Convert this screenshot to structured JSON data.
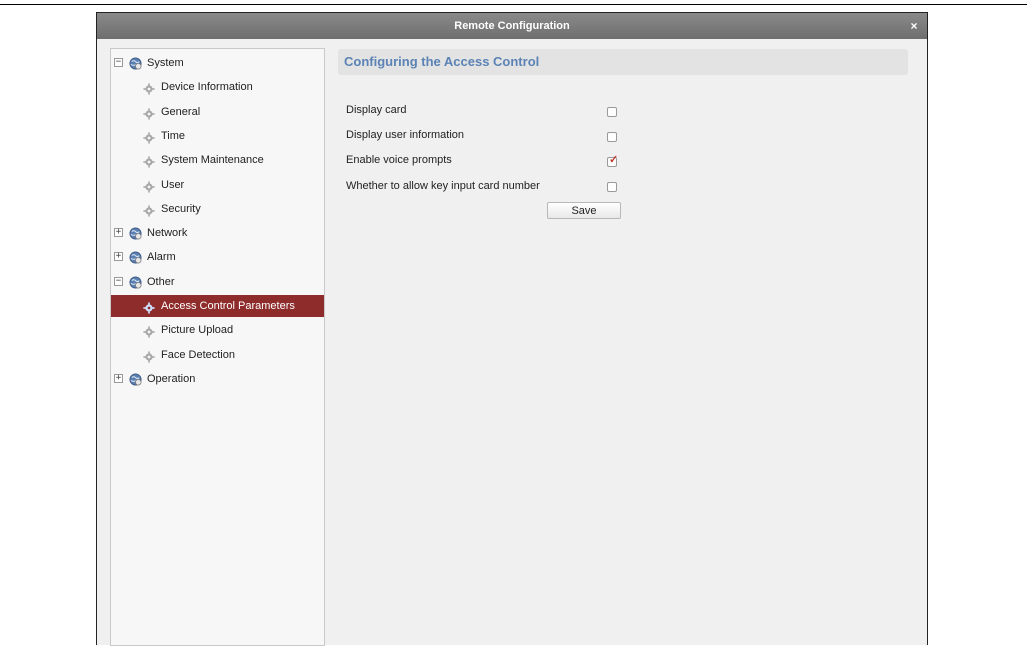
{
  "window": {
    "title": "Remote Configuration",
    "close_label": "×"
  },
  "tree": {
    "items": [
      {
        "label": "System",
        "level": 0,
        "expanded": true,
        "icon": "globe-icon"
      },
      {
        "label": "Device Information",
        "level": 1,
        "icon": "gear-icon"
      },
      {
        "label": "General",
        "level": 1,
        "icon": "gear-icon"
      },
      {
        "label": "Time",
        "level": 1,
        "icon": "gear-icon"
      },
      {
        "label": "System Maintenance",
        "level": 1,
        "icon": "gear-icon"
      },
      {
        "label": "User",
        "level": 1,
        "icon": "gear-icon"
      },
      {
        "label": "Security",
        "level": 1,
        "icon": "gear-icon"
      },
      {
        "label": "Network",
        "level": 0,
        "expanded": false,
        "icon": "globe-icon"
      },
      {
        "label": "Alarm",
        "level": 0,
        "expanded": false,
        "icon": "globe-icon"
      },
      {
        "label": "Other",
        "level": 0,
        "expanded": true,
        "icon": "globe-icon"
      },
      {
        "label": "Access Control Parameters",
        "level": 1,
        "selected": true,
        "icon": "gear-icon"
      },
      {
        "label": "Picture Upload",
        "level": 1,
        "icon": "gear-icon"
      },
      {
        "label": "Face Detection",
        "level": 1,
        "icon": "gear-icon"
      },
      {
        "label": "Operation",
        "level": 0,
        "expanded": false,
        "icon": "globe-icon"
      }
    ]
  },
  "content": {
    "title": "Configuring the Access Control",
    "options": [
      {
        "label": "Display card",
        "checked": false
      },
      {
        "label": "Display user information",
        "checked": false
      },
      {
        "label": "Enable voice prompts",
        "checked": true
      },
      {
        "label": "Whether to allow key input card number",
        "checked": false
      }
    ],
    "save_label": "Save"
  },
  "colors": {
    "selected_bg": "#8e2b2b",
    "title_text": "#5b83b5",
    "check_mark": "#c0392b",
    "titlebar_bg": "#7a7a7a"
  }
}
